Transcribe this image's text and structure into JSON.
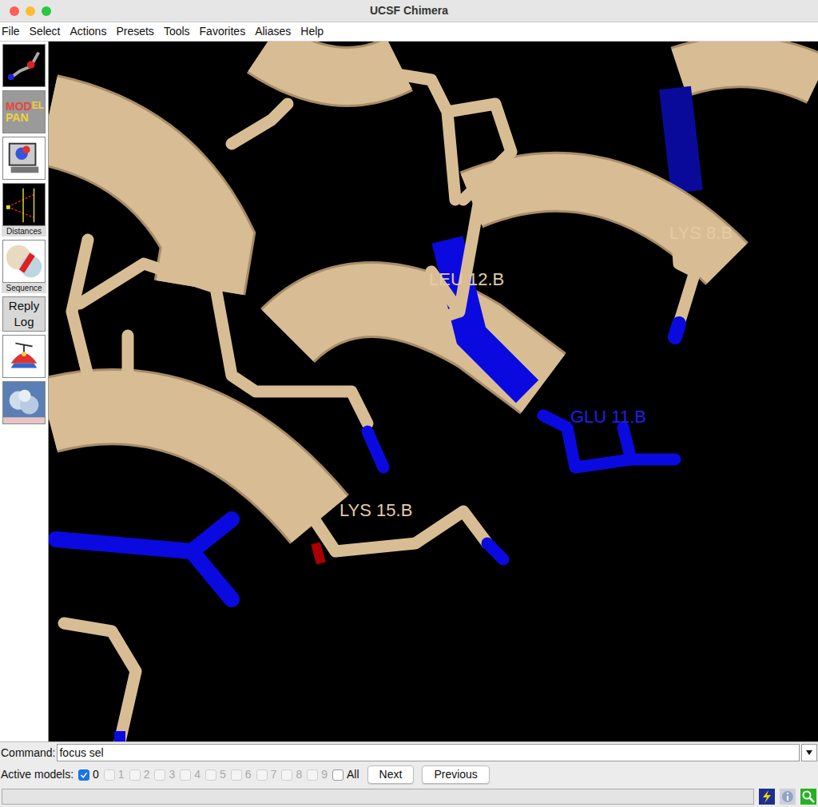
{
  "window": {
    "title": "UCSF Chimera"
  },
  "menu": [
    "File",
    "Select",
    "Actions",
    "Presets",
    "Tools",
    "Favorites",
    "Aliases",
    "Help"
  ],
  "toolbar": [
    {
      "kind": "sticks"
    },
    {
      "kind": "model-panel",
      "logo": [
        {
          "text": "MOD",
          "color": "#e8463a"
        },
        {
          "text": "EL",
          "color": "#f2d13a"
        },
        {
          "text": "PAN",
          "color": "#f2d13a"
        }
      ]
    },
    {
      "kind": "computer"
    },
    {
      "kind": "distances",
      "label": "Distances"
    },
    {
      "kind": "sequence",
      "label": "Sequence"
    },
    {
      "kind": "reply-log",
      "label": "Reply Log"
    },
    {
      "kind": "hat"
    },
    {
      "kind": "surface"
    }
  ],
  "scene": {
    "labels": [
      {
        "text": "LYS 8.B",
        "color": "#e3cba6"
      },
      {
        "text": "LEU 12.B",
        "color": "#e3cba6"
      },
      {
        "text": "GLU 11.B",
        "color": "#1e1ef0"
      },
      {
        "text": "LYS 15.B",
        "color": "#e3cba6"
      }
    ]
  },
  "command": {
    "label": "Command:",
    "value": "focus sel"
  },
  "active_models": {
    "label": "Active models:",
    "models": [
      {
        "label": "0",
        "checked": true,
        "disabled": false
      },
      {
        "label": "1",
        "checked": false,
        "disabled": true
      },
      {
        "label": "2",
        "checked": false,
        "disabled": true
      },
      {
        "label": "3",
        "checked": false,
        "disabled": true
      },
      {
        "label": "4",
        "checked": false,
        "disabled": true
      },
      {
        "label": "5",
        "checked": false,
        "disabled": true
      },
      {
        "label": "6",
        "checked": false,
        "disabled": true
      },
      {
        "label": "7",
        "checked": false,
        "disabled": true
      },
      {
        "label": "8",
        "checked": false,
        "disabled": true
      },
      {
        "label": "9",
        "checked": false,
        "disabled": true
      }
    ],
    "all": {
      "label": "All",
      "checked": false
    },
    "buttons": [
      "Next",
      "Previous"
    ]
  }
}
